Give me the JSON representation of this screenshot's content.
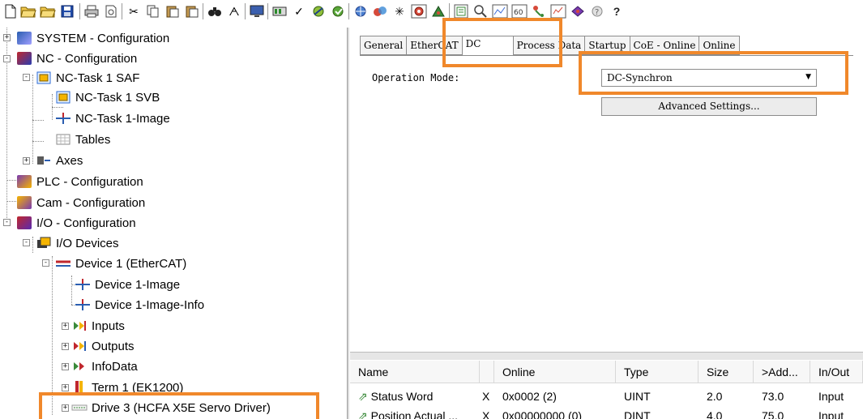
{
  "toolbar": {
    "icons": [
      "new-file-icon",
      "open-file-icon",
      "open-folder-icon",
      "save-icon",
      "print-icon",
      "print-preview-icon",
      "cut-icon",
      "copy-icon",
      "paste-icon",
      "paste-special-icon",
      "find-icon",
      "find-next-icon",
      "monitor-icon",
      "activate-config-icon",
      "check-icon",
      "config-mode-icon",
      "run-mode-icon",
      "network-icon",
      "scan-icon",
      "target-icon",
      "login-icon",
      "file-text-icon",
      "zoom-icon",
      "scope-icon",
      "watch-icon",
      "axis-icon",
      "io-icon",
      "book-icon",
      "settings-icon",
      "help-icon"
    ]
  },
  "tree": {
    "items": [
      {
        "label": "SYSTEM - Configuration",
        "icon": "system-config-icon"
      },
      {
        "label": "NC - Configuration",
        "icon": "nc-config-icon"
      },
      {
        "label": "NC-Task 1 SAF",
        "icon": "nc-task-icon"
      },
      {
        "label": "NC-Task 1 SVB",
        "icon": "nc-task-icon"
      },
      {
        "label": "NC-Task 1-Image",
        "icon": "image-icon"
      },
      {
        "label": "Tables",
        "icon": "table-icon"
      },
      {
        "label": "Axes",
        "icon": "axes-icon"
      },
      {
        "label": "PLC - Configuration",
        "icon": "plc-config-icon"
      },
      {
        "label": "Cam - Configuration",
        "icon": "cam-config-icon"
      },
      {
        "label": "I/O - Configuration",
        "icon": "io-config-icon"
      },
      {
        "label": "I/O Devices",
        "icon": "io-devices-icon"
      },
      {
        "label": "Device 1 (EtherCAT)",
        "icon": "ethercat-device-icon"
      },
      {
        "label": "Device 1-Image",
        "icon": "image-icon"
      },
      {
        "label": "Device 1-Image-Info",
        "icon": "image-icon"
      },
      {
        "label": "Inputs",
        "icon": "inputs-icon"
      },
      {
        "label": "Outputs",
        "icon": "outputs-icon"
      },
      {
        "label": "InfoData",
        "icon": "infodata-icon"
      },
      {
        "label": "Term 1 (EK1200)",
        "icon": "terminal-icon"
      },
      {
        "label": "Drive 3 (HCFA X5E Servo Driver)",
        "icon": "drive-icon"
      }
    ]
  },
  "tabs": {
    "items": [
      "General",
      "EtherCAT",
      "DC",
      "Process Data",
      "Startup",
      "CoE - Online",
      "Online"
    ],
    "active": "DC"
  },
  "dc": {
    "operation_mode_label": "Operation Mode:",
    "operation_mode_value": "DC-Synchron",
    "advanced_button": "Advanced Settings..."
  },
  "grid": {
    "columns": [
      "Name",
      "",
      "Online",
      "Type",
      "Size",
      ">Add...",
      "In/Out"
    ],
    "rows": [
      {
        "name": "Status Word",
        "x": "X",
        "online": "0x0002 (2)",
        "type": "UINT",
        "size": "2.0",
        "addr": "73.0",
        "inout": "Input"
      },
      {
        "name": "Position Actual ...",
        "x": "X",
        "online": "0x00000000 (0)",
        "type": "DINT",
        "size": "4.0",
        "addr": "75.0",
        "inout": "Input"
      }
    ]
  },
  "colors": {
    "highlight": "#f0882b"
  }
}
